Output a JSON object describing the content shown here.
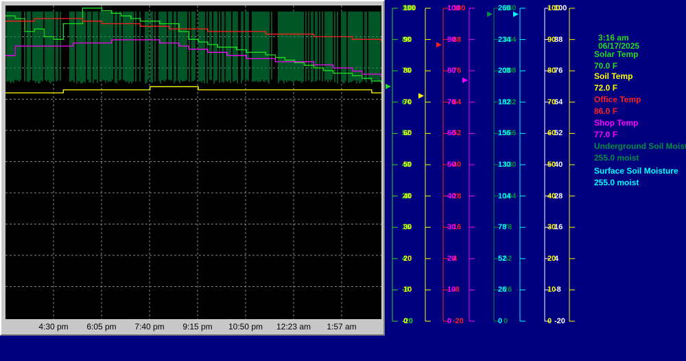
{
  "chart_data": {
    "type": "line",
    "x_tick_labels": [
      "4:30 pm",
      "6:05 pm",
      "7:40 pm",
      "9:15 pm",
      "10:50 pm",
      "12:23 am",
      "1:57 am"
    ],
    "grid": true,
    "series": [
      {
        "name": "Solar Temp",
        "color": "#22dd22",
        "unit": "F",
        "ylim": [
          -20,
          100
        ],
        "current": 70.0,
        "values": [
          96,
          95,
          90,
          91,
          88,
          87,
          93,
          93,
          99,
          99,
          98,
          97,
          96,
          95,
          94,
          94,
          93,
          93,
          90,
          87,
          86,
          85,
          84,
          84,
          83,
          82,
          82,
          81,
          80,
          79,
          78,
          77,
          76,
          75,
          74,
          74,
          73,
          72,
          71,
          70
        ]
      },
      {
        "name": "Soil Temp",
        "color": "#ffff00",
        "unit": "F",
        "ylim": [
          0,
          100
        ],
        "current": 72.0,
        "values": [
          72,
          72,
          72,
          72,
          72,
          72,
          73,
          73,
          73,
          73,
          73,
          73,
          73,
          73,
          73,
          74,
          74,
          74,
          74,
          74,
          73,
          73,
          73,
          73,
          73,
          73,
          73,
          73,
          73,
          73,
          73,
          73,
          73,
          73,
          73,
          73,
          73,
          73,
          72,
          72
        ]
      },
      {
        "name": "Office Temp",
        "color": "#ff2020",
        "unit": "F",
        "ylim": [
          -20,
          100
        ],
        "current": 86.0,
        "values": [
          94,
          94,
          94,
          95,
          95,
          95,
          95,
          95,
          94,
          94,
          93,
          93,
          93,
          93,
          92,
          92,
          92,
          91,
          91,
          91,
          91,
          90,
          90,
          90,
          90,
          90,
          90,
          89,
          89,
          89,
          89,
          89,
          88,
          88,
          88,
          88,
          87,
          87,
          87,
          86
        ]
      },
      {
        "name": "Shop Temp",
        "color": "#ff00ff",
        "unit": "F",
        "ylim": [
          0,
          100
        ],
        "current": 77.0,
        "values": [
          84,
          87,
          87,
          87,
          87,
          87,
          87,
          88,
          88,
          88,
          88,
          89,
          89,
          89,
          89,
          89,
          88,
          88,
          87,
          86,
          86,
          85,
          85,
          84,
          84,
          83,
          83,
          83,
          82,
          82,
          82,
          82,
          81,
          81,
          80,
          80,
          79,
          78,
          78,
          77
        ]
      },
      {
        "name": "Underground Soil Moisture",
        "color": "#009040",
        "unit": "moist",
        "ylim": [
          0,
          260
        ],
        "current": 255.0,
        "values": [
          255,
          255,
          255,
          255,
          255,
          255,
          255,
          255,
          255,
          255,
          255,
          255,
          255,
          255,
          255,
          255,
          255,
          255,
          255,
          255,
          255,
          255,
          255,
          255,
          255,
          255,
          255,
          255,
          255,
          255,
          255,
          255,
          255,
          255,
          255,
          255,
          255,
          255,
          255,
          255
        ]
      },
      {
        "name": "Surface Soil Moisture",
        "color": "#00ffff",
        "unit": "moist",
        "ylim": [
          0,
          260
        ],
        "current": 255.0,
        "values": [
          255,
          255,
          255,
          255,
          255,
          255,
          255,
          255,
          255,
          255,
          255,
          255,
          255,
          255,
          255,
          255,
          255,
          255,
          255,
          255,
          255,
          255,
          255,
          255,
          255,
          255,
          255,
          255,
          255,
          255,
          255,
          255,
          255,
          255,
          255,
          255,
          255,
          255,
          255,
          255
        ]
      }
    ],
    "y_axes": [
      {
        "id": "solar",
        "color": "#22dd22",
        "ticks": [
          "100",
          "88",
          "76",
          "64",
          "52",
          "40",
          "28",
          "16",
          "4",
          "-8",
          "-20"
        ]
      },
      {
        "id": "soil",
        "color": "#ffff00",
        "ticks": [
          "100",
          "90",
          "80",
          "70",
          "60",
          "50",
          "40",
          "30",
          "20",
          "10",
          "0"
        ]
      },
      {
        "id": "office",
        "color": "#ff2020",
        "ticks": [
          "100",
          "88",
          "76",
          "64",
          "52",
          "40",
          "28",
          "16",
          "4",
          "-8",
          "-20"
        ]
      },
      {
        "id": "shop",
        "color": "#ff00ff",
        "ticks": [
          "100",
          "90",
          "80",
          "70",
          "60",
          "50",
          "40",
          "30",
          "20",
          "10",
          "0"
        ]
      },
      {
        "id": "underground",
        "color": "#009040",
        "ticks": [
          "260",
          "234",
          "208",
          "182",
          "156",
          "130",
          "104",
          "78",
          "52",
          "26",
          "0"
        ]
      },
      {
        "id": "surface",
        "color": "#00ffff",
        "ticks": [
          "260",
          "234",
          "208",
          "182",
          "156",
          "130",
          "104",
          "78",
          "52",
          "26",
          "0"
        ]
      },
      {
        "id": "ext-a",
        "color": "#ffffff",
        "ticks": [
          "100",
          "88",
          "76",
          "64",
          "52",
          "40",
          "28",
          "16",
          "4",
          "-8",
          "-20"
        ]
      },
      {
        "id": "ext-b",
        "color": "#ffff00",
        "ticks": [
          "100",
          "90",
          "80",
          "70",
          "60",
          "50",
          "40",
          "30",
          "20",
          "10",
          "0"
        ]
      }
    ]
  },
  "readout": {
    "time": "3:16 am",
    "date": "06/17/2025",
    "entries": [
      {
        "label": "Solar Temp",
        "value": "70.0  F",
        "color": "#22dd22"
      },
      {
        "label": "Soil Temp",
        "value": "72.0  F",
        "color": "#ffff00"
      },
      {
        "label": "Office Temp",
        "value": "86.0  F",
        "color": "#ff2020"
      },
      {
        "label": "Shop Temp",
        "value": "77.0  F",
        "color": "#ff00ff"
      },
      {
        "label": "Underground Soil Moisture",
        "value": "255.0 moist",
        "color": "#009040"
      },
      {
        "label": "Surface Soil Moisture",
        "value": "255.0 moist",
        "color": "#00ffff"
      }
    ]
  }
}
